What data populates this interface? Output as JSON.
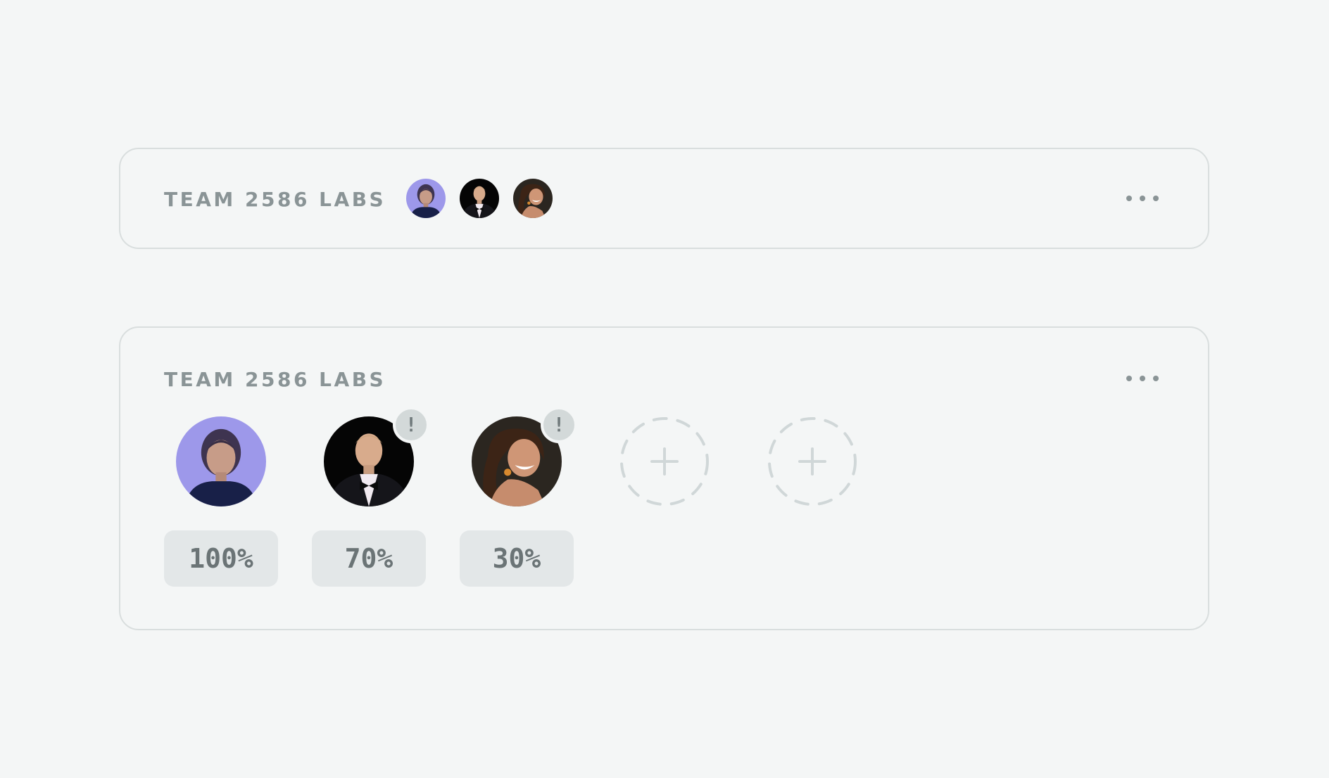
{
  "compact_card": {
    "title": "TEAM 2586 LABS",
    "avatars": [
      "member-1",
      "member-2",
      "member-3"
    ]
  },
  "expanded_card": {
    "title": "TEAM 2586 LABS",
    "members": [
      {
        "progress": "100%",
        "alert": ""
      },
      {
        "progress": "70%",
        "alert": "!"
      },
      {
        "progress": "30%",
        "alert": "!"
      }
    ],
    "add_slots": 2
  },
  "icons": {
    "more": "more-horizontal-icon",
    "add": "add-member-icon",
    "alert": "alert-icon"
  },
  "colors": {
    "background": "#f4f6f6",
    "card_border": "#d9dede",
    "title": "#8a9496",
    "chip_background": "#e3e7e8",
    "chip_text": "#6b7476",
    "badge_background": "#d3d9d9",
    "dashed": "#d0d7d8"
  }
}
